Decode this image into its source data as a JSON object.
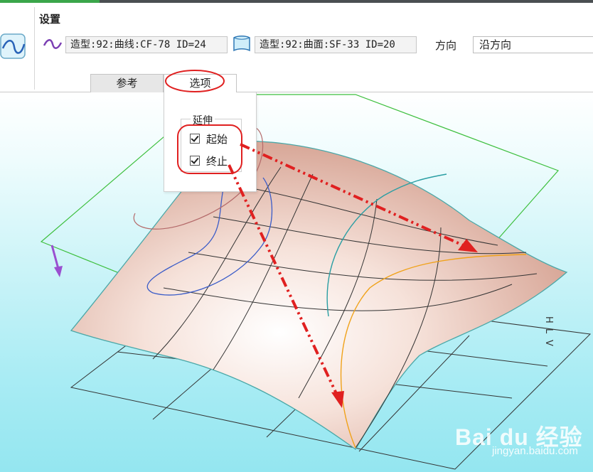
{
  "ribbon": {
    "section_title": "设置",
    "curve_field": "造型:92:曲线:CF-78 ID=24",
    "surface_field": "造型:92:曲面:SF-33 ID=20",
    "direction_label": "方向",
    "direction_value": "沿方向"
  },
  "tabs": [
    {
      "label": "参考",
      "active": false
    },
    {
      "label": "选项",
      "active": true
    }
  ],
  "options_panel": {
    "group_title": "延伸",
    "start_label": "起始",
    "start_checked": true,
    "end_label": "终止",
    "end_checked": true
  },
  "viewport": {
    "triad_labels": [
      "H",
      "L",
      "V"
    ]
  },
  "watermark": {
    "logo": "Bai du 经验",
    "url": "jingyan.baidu.com"
  },
  "colors": {
    "accent_green": "#3aa64a",
    "annotation_red": "#e02020",
    "surface_fill": "#e9c8bd",
    "plane_edge": "#3dbf3d"
  },
  "icons": {
    "ribbon_main": "curve-on-surface-icon",
    "curve": "curve-icon",
    "surface": "surface-icon"
  }
}
